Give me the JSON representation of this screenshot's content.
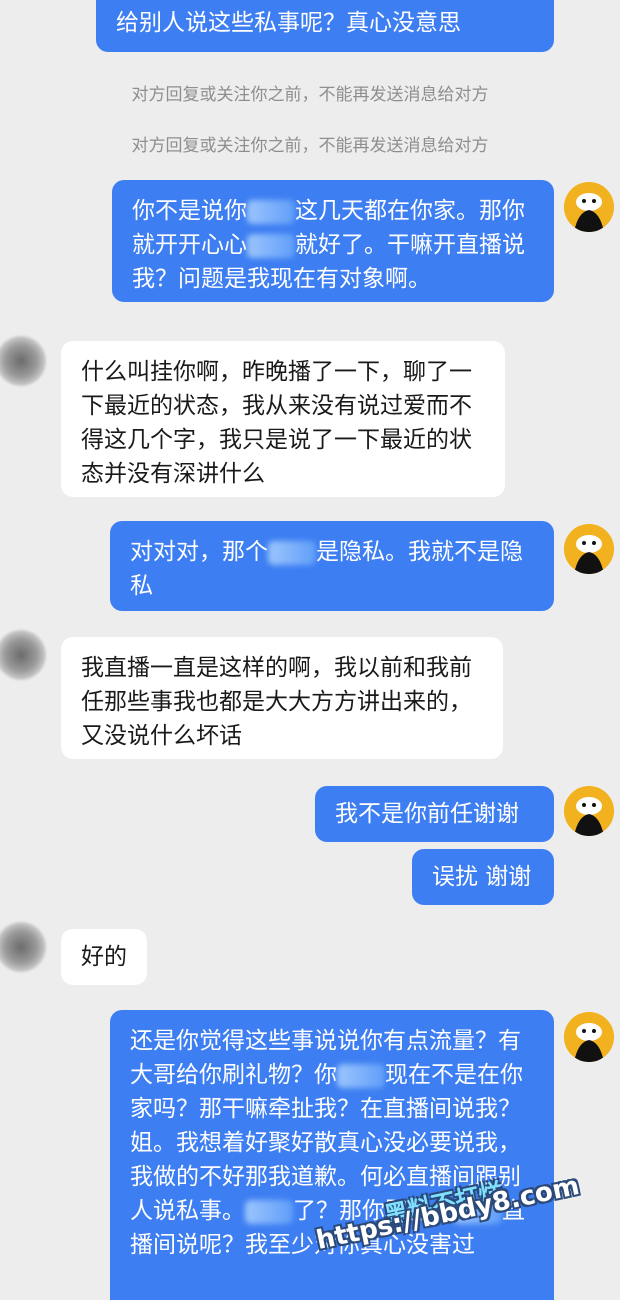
{
  "messages": {
    "m0": "给别人说这些私事呢？真心没意思",
    "notice1": "对方回复或关注你之前，不能再发送消息给对方",
    "notice2": "对方回复或关注你之前，不能再发送消息给对方",
    "m1a": "你不是说你",
    "m1b": "这几天都在你家。那你就开开心心",
    "m1c": "就好了。干嘛开直播说我？问题是我现在有对象啊。",
    "m2": "什么叫挂你啊，昨晚播了一下，聊了一下最近的状态，我从来没有说过爱而不得这几个字，我只是说了一下最近的状态并没有深讲什么",
    "m3a": "对对对，那个",
    "m3b": "是隐私。我就不是隐私",
    "m4": "我直播一直是这样的啊，我以前和我前任那些事我也都是大大方方讲出来的，又没说什么坏话",
    "m5": "我不是你前任谢谢",
    "m6": "误扰 谢谢",
    "m7": "好的",
    "m8a": "还是你觉得这些事说说你有点流量？有大哥给你刷礼物？你",
    "m8b": "现在不是在你家吗？那干嘛牵扯我？在直播间说我？姐。我想着好聚好散真心没必要说我，我做的不好那我道歉。何必直播间跟别人说私事。",
    "m8c": "了？那你跟你几",
    "m8d": "直播间说呢？我至少对你真心没害过"
  },
  "watermark": {
    "line1": "黑料不打烊",
    "line2": "https://bbdy8.com"
  },
  "colors": {
    "sent_bubble": "#3d7ef2",
    "received_bubble": "#ffffff",
    "background": "#ededed"
  }
}
